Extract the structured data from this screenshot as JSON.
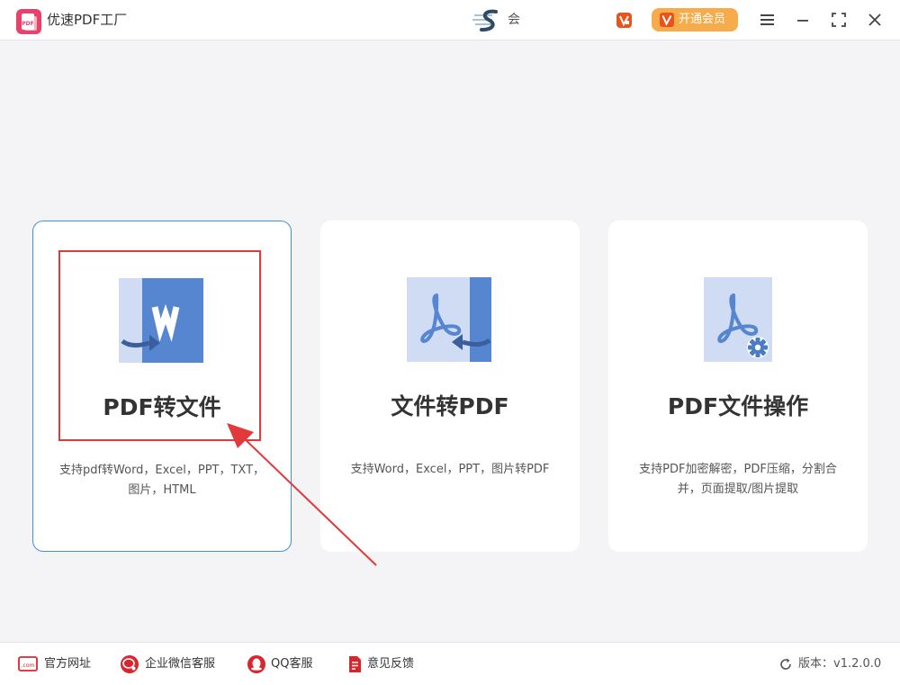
{
  "app": {
    "title": "优速PDF工厂",
    "logo_text": "PDF",
    "center_text": "会",
    "vip_label": "开通会员"
  },
  "colors": {
    "brand": "#e8416a",
    "vip": "#f6ac4b",
    "vip_icon": "#e9541d",
    "card_border_selected": "#3d93db",
    "icon_blue": "#5686d0",
    "icon_light": "#cfdcf4",
    "annotation_red": "#e23a3a"
  },
  "window_controls": [
    "menu-icon",
    "minimize-icon",
    "maximize-icon",
    "close-icon"
  ],
  "cards": [
    {
      "title": "PDF转文件",
      "desc_line1": "支持pdf转Word，Excel，PPT，TXT，",
      "desc_line2": "图片，HTML",
      "icon": "pdf-to-word-icon",
      "selected": true
    },
    {
      "title": "文件转PDF",
      "desc_line1": "支持Word，Excel，PPT，图片转PDF",
      "desc_line2": "",
      "icon": "file-to-pdf-icon",
      "selected": false
    },
    {
      "title": "PDF文件操作",
      "desc_line1": "支持PDF加密解密，PDF压缩，分割合",
      "desc_line2": "并，页面提取/图片提取",
      "icon": "pdf-settings-icon",
      "selected": false
    }
  ],
  "footer": {
    "links": [
      {
        "label": "官方网址",
        "icon": "website-icon",
        "icon_text": ".com"
      },
      {
        "label": "企业微信客服",
        "icon": "wechat-work-icon"
      },
      {
        "label": "QQ客服",
        "icon": "qq-icon"
      },
      {
        "label": "意见反馈",
        "icon": "feedback-icon"
      }
    ],
    "version": "版本：v1.2.0.0"
  }
}
